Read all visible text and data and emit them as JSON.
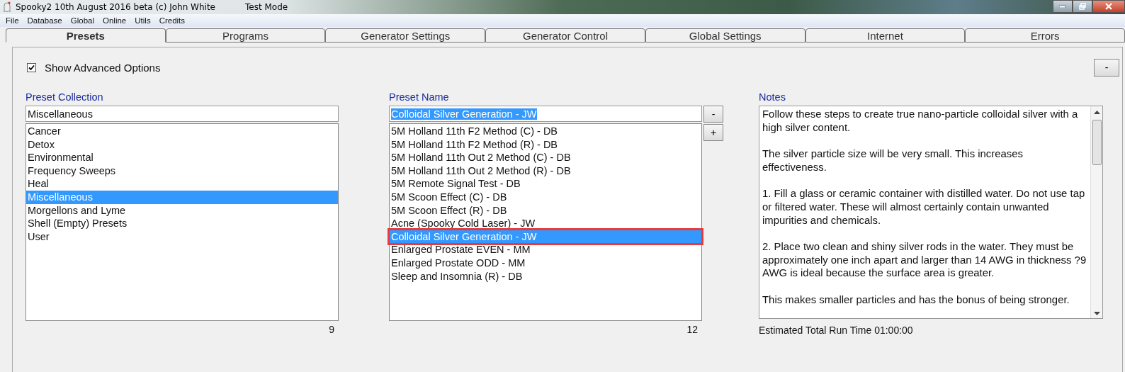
{
  "window": {
    "title": "Spooky2 10th August 2016 beta (c) John White",
    "mode": "Test Mode"
  },
  "menu": [
    "File",
    "Database",
    "Global",
    "Online",
    "Utils",
    "Credits"
  ],
  "tabs": [
    {
      "label": "Presets",
      "selected": true
    },
    {
      "label": "Programs",
      "selected": false
    },
    {
      "label": "Generator Settings",
      "selected": false
    },
    {
      "label": "Generator Control",
      "selected": false
    },
    {
      "label": "Global Settings",
      "selected": false
    },
    {
      "label": "Internet",
      "selected": false
    },
    {
      "label": "Errors",
      "selected": false
    }
  ],
  "show_advanced": {
    "label": "Show Advanced Options",
    "checked": true
  },
  "collapse_button": "-",
  "preset_collection": {
    "heading": "Preset Collection",
    "value": "Miscellaneous",
    "count": "9",
    "items": [
      {
        "label": "Cancer",
        "selected": false
      },
      {
        "label": "Detox",
        "selected": false
      },
      {
        "label": "Environmental",
        "selected": false
      },
      {
        "label": "Frequency Sweeps",
        "selected": false
      },
      {
        "label": "Heal",
        "selected": false
      },
      {
        "label": "Miscellaneous",
        "selected": true
      },
      {
        "label": "Morgellons and Lyme",
        "selected": false
      },
      {
        "label": "Shell (Empty) Presets",
        "selected": false
      },
      {
        "label": "User",
        "selected": false
      }
    ]
  },
  "preset_name": {
    "heading": "Preset Name",
    "value": "Colloidal Silver Generation - JW",
    "count": "12",
    "buttons": [
      "-",
      "+"
    ],
    "items": [
      {
        "label": "5M Holland 11th F2 Method (C) - DB",
        "selected": false,
        "outlined": false
      },
      {
        "label": "5M Holland 11th F2 Method (R) - DB",
        "selected": false,
        "outlined": false
      },
      {
        "label": "5M Holland 11th Out 2 Method (C) - DB",
        "selected": false,
        "outlined": false
      },
      {
        "label": "5M Holland 11th Out 2 Method (R) - DB",
        "selected": false,
        "outlined": false
      },
      {
        "label": "5M Remote Signal Test - DB",
        "selected": false,
        "outlined": false
      },
      {
        "label": "5M Scoon Effect (C) - DB",
        "selected": false,
        "outlined": false
      },
      {
        "label": "5M Scoon Effect (R) - DB",
        "selected": false,
        "outlined": false
      },
      {
        "label": "Acne (Spooky Cold Laser) - JW",
        "selected": false,
        "outlined": false
      },
      {
        "label": "Colloidal Silver Generation - JW",
        "selected": true,
        "outlined": true
      },
      {
        "label": "Enlarged Prostate EVEN - MM",
        "selected": false,
        "outlined": false
      },
      {
        "label": "Enlarged Prostate ODD - MM",
        "selected": false,
        "outlined": false
      },
      {
        "label": "Sleep and Insomnia (R) - DB",
        "selected": false,
        "outlined": false
      }
    ]
  },
  "notes": {
    "heading": "Notes",
    "paragraphs": [
      "Follow these steps to create true nano-particle colloidal silver with a high silver content.",
      "The silver particle size will be very small. This increases effectiveness.",
      "1. Fill a glass or ceramic container with distilled water. Do not use tap or filtered water. These will almost certainly contain unwanted impurities and chemicals.",
      "2. Place two clean and shiny silver rods in the water. They must be approximately one inch apart and larger than 14 AWG in thickness ?9 AWG is ideal because the surface area is greater.",
      "This makes smaller particles and has the bonus of being stronger."
    ],
    "run_time": "Estimated Total Run Time 01:00:00"
  }
}
